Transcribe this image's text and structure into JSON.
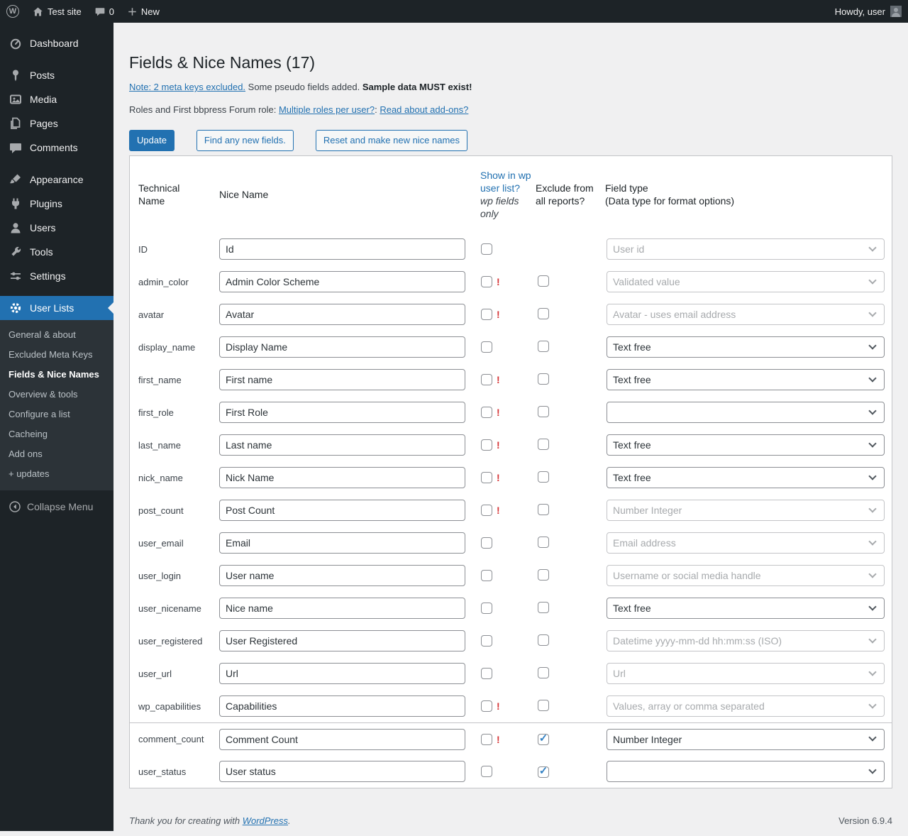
{
  "colors": {
    "accent": "#2271b1",
    "warning": "#d63638",
    "admin_bar_bg": "#1d2327",
    "sidebar_bg": "#1d2327",
    "submenu_bg": "#2c3338",
    "content_bg": "#f0f0f1",
    "table_border": "#c3c4c7",
    "checkbox_check": "#3582c4"
  },
  "admin_bar": {
    "site_name": "Test site",
    "comments_count": "0",
    "new_label": "New",
    "howdy": "Howdy, user"
  },
  "sidebar": {
    "items": [
      {
        "label": "Dashboard",
        "icon": "dashboard-icon"
      },
      {
        "label": "Posts",
        "icon": "pushpin-icon"
      },
      {
        "label": "Media",
        "icon": "media-icon"
      },
      {
        "label": "Pages",
        "icon": "pages-icon"
      },
      {
        "label": "Comments",
        "icon": "comments-icon"
      },
      {
        "label": "Appearance",
        "icon": "appearance-icon"
      },
      {
        "label": "Plugins",
        "icon": "plugin-icon"
      },
      {
        "label": "Users",
        "icon": "users-icon"
      },
      {
        "label": "Tools",
        "icon": "tools-icon"
      },
      {
        "label": "Settings",
        "icon": "settings-icon"
      }
    ],
    "user_lists_label": "User Lists",
    "submenu": [
      "General & about",
      "Excluded Meta Keys",
      "Fields & Nice Names",
      "Overview & tools",
      "Configure a list",
      "Cacheing",
      "Add ons",
      "+ updates"
    ],
    "current_submenu": "Fields & Nice Names",
    "collapse_label": "Collapse Menu"
  },
  "main": {
    "title": "Fields & Nice Names (17)",
    "note": {
      "link": "Note: 2 meta keys excluded.",
      "text": " Some pseudo fields added. ",
      "bold": "Sample data MUST exist!"
    },
    "roles": {
      "prefix": "Roles and First bbpress Forum role: ",
      "link1": "Multiple roles per user?",
      "separator": ": ",
      "link2": "Read about add-ons?"
    },
    "buttons": {
      "update": "Update",
      "find_new": "Find any new fields.",
      "reset": "Reset and make new nice names"
    }
  },
  "table": {
    "headers": {
      "technical_name": "Technical Name",
      "nice_name": "Nice Name",
      "show_link": "Show in wp user list?",
      "show_note": "wp fields only",
      "exclude": "Exclude from all reports?",
      "field_type_line1": "Field type",
      "field_type_line2": "(Data type for format options)"
    },
    "rows": [
      {
        "technical_name": "ID",
        "nice_name": "Id",
        "show_checked": false,
        "warning": false,
        "exclude_present": false,
        "exclude_checked": false,
        "field_type": "User id",
        "field_type_enabled": false,
        "separator": false
      },
      {
        "technical_name": "admin_color",
        "nice_name": "Admin Color Scheme",
        "show_checked": false,
        "warning": true,
        "exclude_present": true,
        "exclude_checked": false,
        "field_type": "Validated value",
        "field_type_enabled": false,
        "separator": false
      },
      {
        "technical_name": "avatar",
        "nice_name": "Avatar",
        "show_checked": false,
        "warning": true,
        "exclude_present": true,
        "exclude_checked": false,
        "field_type": "Avatar - uses email address",
        "field_type_enabled": false,
        "separator": false
      },
      {
        "technical_name": "display_name",
        "nice_name": "Display Name",
        "show_checked": false,
        "warning": false,
        "exclude_present": true,
        "exclude_checked": false,
        "field_type": "Text free",
        "field_type_enabled": true,
        "separator": false
      },
      {
        "technical_name": "first_name",
        "nice_name": "First name",
        "show_checked": false,
        "warning": true,
        "exclude_present": true,
        "exclude_checked": false,
        "field_type": "Text free",
        "field_type_enabled": true,
        "separator": false
      },
      {
        "technical_name": "first_role",
        "nice_name": "First Role",
        "show_checked": false,
        "warning": true,
        "exclude_present": true,
        "exclude_checked": false,
        "field_type": "",
        "field_type_enabled": true,
        "separator": false
      },
      {
        "technical_name": "last_name",
        "nice_name": "Last name",
        "show_checked": false,
        "warning": true,
        "exclude_present": true,
        "exclude_checked": false,
        "field_type": "Text free",
        "field_type_enabled": true,
        "separator": false
      },
      {
        "technical_name": "nick_name",
        "nice_name": "Nick Name",
        "show_checked": false,
        "warning": true,
        "exclude_present": true,
        "exclude_checked": false,
        "field_type": "Text free",
        "field_type_enabled": true,
        "separator": false
      },
      {
        "technical_name": "post_count",
        "nice_name": "Post Count",
        "show_checked": false,
        "warning": true,
        "exclude_present": true,
        "exclude_checked": false,
        "field_type": "Number Integer",
        "field_type_enabled": false,
        "separator": false
      },
      {
        "technical_name": "user_email",
        "nice_name": "Email",
        "show_checked": false,
        "warning": false,
        "exclude_present": true,
        "exclude_checked": false,
        "field_type": "Email address",
        "field_type_enabled": false,
        "separator": false
      },
      {
        "technical_name": "user_login",
        "nice_name": "User name",
        "show_checked": false,
        "warning": false,
        "exclude_present": true,
        "exclude_checked": false,
        "field_type": "Username or social media handle",
        "field_type_enabled": false,
        "separator": false
      },
      {
        "technical_name": "user_nicename",
        "nice_name": "Nice name",
        "show_checked": false,
        "warning": false,
        "exclude_present": true,
        "exclude_checked": false,
        "field_type": "Text free",
        "field_type_enabled": true,
        "separator": false
      },
      {
        "technical_name": "user_registered",
        "nice_name": "User Registered",
        "show_checked": false,
        "warning": false,
        "exclude_present": true,
        "exclude_checked": false,
        "field_type": "Datetime yyyy-mm-dd hh:mm:ss (ISO)",
        "field_type_enabled": false,
        "separator": false
      },
      {
        "technical_name": "user_url",
        "nice_name": "Url",
        "show_checked": false,
        "warning": false,
        "exclude_present": true,
        "exclude_checked": false,
        "field_type": "Url",
        "field_type_enabled": false,
        "separator": false
      },
      {
        "technical_name": "wp_capabilities",
        "nice_name": "Capabilities",
        "show_checked": false,
        "warning": true,
        "exclude_present": true,
        "exclude_checked": false,
        "field_type": "Values, array or comma separated",
        "field_type_enabled": false,
        "separator": false
      },
      {
        "technical_name": "comment_count",
        "nice_name": "Comment Count",
        "show_checked": false,
        "warning": true,
        "exclude_present": true,
        "exclude_checked": true,
        "field_type": "Number Integer",
        "field_type_enabled": true,
        "separator": true
      },
      {
        "technical_name": "user_status",
        "nice_name": "User status",
        "show_checked": false,
        "warning": false,
        "exclude_present": true,
        "exclude_checked": true,
        "field_type": "",
        "field_type_enabled": true,
        "separator": false
      }
    ]
  },
  "footer": {
    "thanks_prefix": "Thank you for creating with ",
    "wordpress_link": "WordPress",
    "thanks_suffix": ".",
    "version": "Version 6.9.4"
  }
}
